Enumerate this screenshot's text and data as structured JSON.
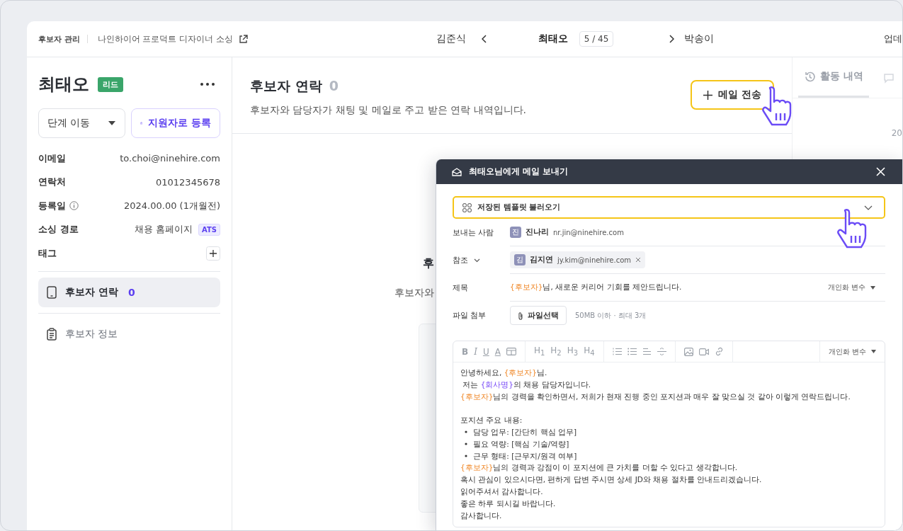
{
  "topbar": {
    "breadcrumb": "후보자 관리",
    "project": "나인하이어 프로덕트 디자이너 소싱",
    "prev_candidate": "김준식",
    "current_candidate": "최태오",
    "counter": "5 / 45",
    "next_candidate": "박송이",
    "right_action": "업데"
  },
  "sidebar": {
    "name": "최태오",
    "badge": {
      "label": "리드",
      "color": "#3aa56a"
    },
    "stage_select": "단계 이동",
    "register_button": "지원자로 등록",
    "info_rows": [
      {
        "kind": "text",
        "label": "이메일",
        "value": "to.choi@ninehire.com"
      },
      {
        "kind": "text",
        "label": "연락처",
        "value": "01012345678"
      },
      {
        "kind": "text",
        "label": "등록일",
        "value": "2024.00.00 (1개월전)",
        "info": true
      },
      {
        "kind": "tag",
        "label": "소싱 경로",
        "value": "채용 홈페이지",
        "tag": "ATS"
      },
      {
        "kind": "add",
        "label": "태그"
      }
    ],
    "nav": [
      {
        "label": "후보자 연락",
        "count": "0",
        "selected": true
      },
      {
        "label": "후보자 정보",
        "selected": false
      }
    ]
  },
  "main": {
    "title": "후보자 연락",
    "count": "0",
    "description": "후보자와 담당자가 채팅 및 메일로 주고 받은 연락 내역입니다.",
    "send_button": {
      "label": "메일 전송",
      "highlighted": true
    },
    "empty_title": "후",
    "empty_text": "후보자와"
  },
  "activity": {
    "tab": "활동 내역",
    "tab_selected": true,
    "date": "20"
  },
  "modal": {
    "title": "최태오님에게 메일 보내기",
    "template_select": {
      "label": "저장된 템플릿 불러오기",
      "highlighted": true
    },
    "sender": {
      "label": "보내는 사람",
      "initial": "진",
      "name": "진나리",
      "email": "nr.jin@ninehire.com"
    },
    "cc": {
      "label": "참조",
      "initial": "김",
      "name": "김지연",
      "email": "jy.kim@ninehire.com"
    },
    "subject": {
      "label": "제목",
      "segments": [
        {
          "kind": "candidate",
          "text": "{후보자}"
        },
        {
          "kind": "plain",
          "text": "님, 새로운 커리어 기회를 제안드립니다."
        }
      ],
      "variable_menu": "개인화 변수"
    },
    "attachment": {
      "label": "파일 첨부",
      "button": "파일선택",
      "hint": "50MB 이하 · 최대 3개"
    },
    "editor": {
      "format_buttons": [
        "B",
        "I",
        "U",
        "A"
      ],
      "heading_buttons": [
        "H$_{1}$",
        "H$_{2}$",
        "H$_{3}$",
        "H$_{4}$"
      ],
      "variable_menu": "개인화 변수",
      "lines": [
        {
          "kind": "text",
          "segments": [
            {
              "kind": "plain",
              "text": "안녕하세요, "
            },
            {
              "kind": "candidate",
              "text": "{후보자}"
            },
            {
              "kind": "plain",
              "text": "님."
            }
          ]
        },
        {
          "kind": "text",
          "segments": [
            {
              "kind": "plain",
              "text": " 저는 "
            },
            {
              "kind": "company",
              "text": "{회사명}"
            },
            {
              "kind": "plain",
              "text": "의 채용 담당자입니다."
            }
          ]
        },
        {
          "kind": "text",
          "segments": [
            {
              "kind": "candidate",
              "text": "{후보자}"
            },
            {
              "kind": "plain",
              "text": "님의 경력을 확인하면서, 저희가 현재 진행 중인 포지션과 매우 잘 맞으실 것 같아 이렇게 연락드립니다."
            }
          ]
        },
        {
          "kind": "blank"
        },
        {
          "kind": "text",
          "segments": [
            {
              "kind": "plain",
              "text": "포지션 주요 내용:"
            }
          ]
        },
        {
          "kind": "bullet",
          "segments": [
            {
              "kind": "plain",
              "text": "담당 업무: [간단히 핵심 업무]"
            }
          ]
        },
        {
          "kind": "bullet",
          "segments": [
            {
              "kind": "plain",
              "text": "필요 역량: [핵심 기술/역량]"
            }
          ]
        },
        {
          "kind": "bullet",
          "segments": [
            {
              "kind": "plain",
              "text": "근무 형태: [근무지/원격 여부]"
            }
          ]
        },
        {
          "kind": "text",
          "segments": [
            {
              "kind": "candidate",
              "text": "{후보자}"
            },
            {
              "kind": "plain",
              "text": "님의 경력과 강점이 이 포지션에 큰 가치를 더할 수 있다고 생각합니다."
            }
          ]
        },
        {
          "kind": "text",
          "segments": [
            {
              "kind": "plain",
              "text": "혹시 관심이 있으시다면, 편하게 답변 주시면 상세 JD와 채용 절차를 안내드리겠습니다."
            }
          ]
        },
        {
          "kind": "text",
          "segments": [
            {
              "kind": "plain",
              "text": "읽어주셔서 감사합니다."
            }
          ]
        },
        {
          "kind": "text",
          "segments": [
            {
              "kind": "plain",
              "text": "좋은 하루 되시길 바랍니다."
            }
          ]
        },
        {
          "kind": "text",
          "segments": [
            {
              "kind": "plain",
              "text": "감사합니다."
            }
          ]
        }
      ]
    }
  }
}
